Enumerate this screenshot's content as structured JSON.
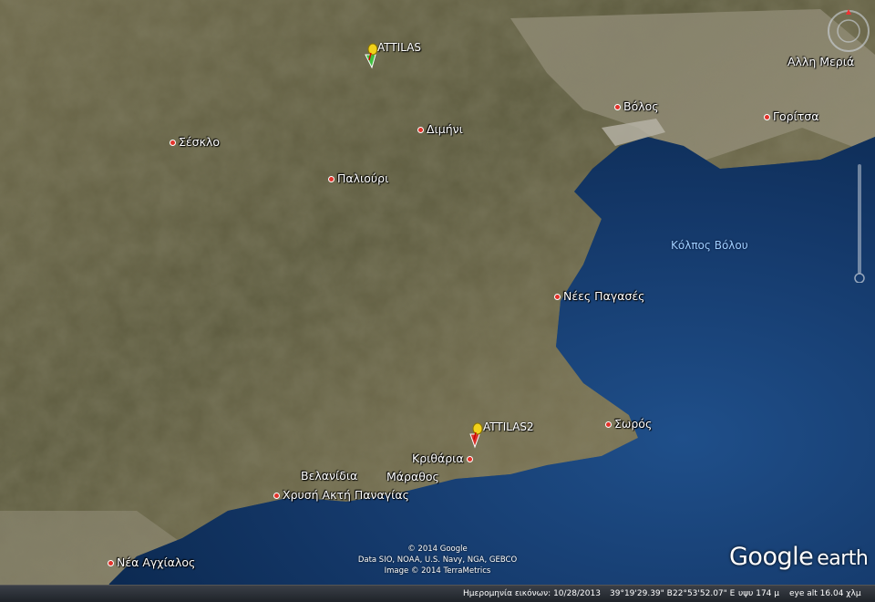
{
  "places": [
    {
      "name": "ATTILAS",
      "kind": "pin"
    },
    {
      "name": "Σέσκλο"
    },
    {
      "name": "Διμήνι"
    },
    {
      "name": "Παλιούρι"
    },
    {
      "name": "Βόλος"
    },
    {
      "name": "Αλλη Μεριά"
    },
    {
      "name": "Γορίτσα"
    },
    {
      "name": "Νέες Παγασές"
    },
    {
      "name": "ATTILAS2",
      "kind": "pin"
    },
    {
      "name": "Σωρός"
    },
    {
      "name": "Κριθάρια"
    },
    {
      "name": "Βελανίδια"
    },
    {
      "name": "Μάραθος"
    },
    {
      "name": "Χρυσή Ακτή Παναγίας"
    },
    {
      "name": "Νέα Αγχίαλος"
    }
  ],
  "sea_label": "Κόλπος Βόλου",
  "credits": {
    "line1": "© 2014 Google",
    "line2": "Data SIO, NOAA, U.S. Navy, NGA, GEBCO",
    "line3": "Image © 2014 TerraMetrics"
  },
  "logo": {
    "word1": "Google",
    "word2": "earth"
  },
  "status": {
    "imagery_date": "Ημερομηνία εικόνων: 10/28/2013",
    "lat": "39°19'29.39\" B",
    "lon": "22°53'52.07\" E",
    "elev": "υψυ   174 μ",
    "eye_alt": "eye alt  16.04 χλμ"
  },
  "colors": {
    "sea": "#123a6b",
    "land": "#6b6545",
    "pin_green": "#3fbf3f",
    "pin_red": "#d9312b",
    "pin_yellow": "#f2d21b"
  }
}
